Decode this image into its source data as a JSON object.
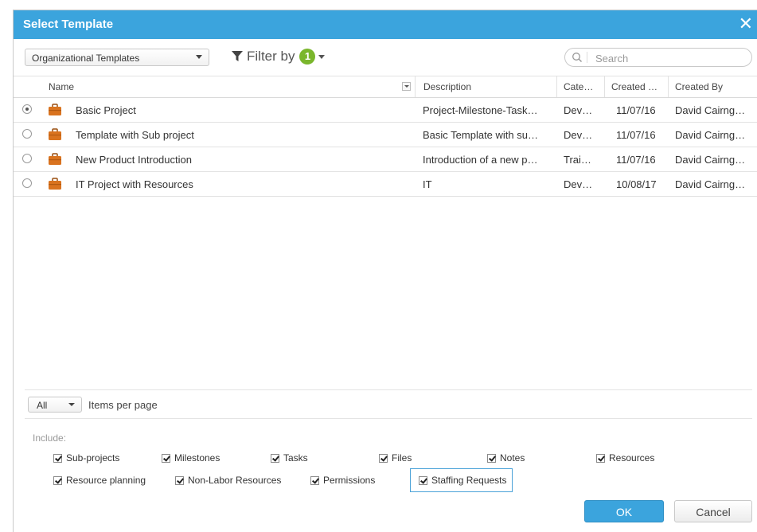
{
  "dialog": {
    "title": "Select Template",
    "close_glyph": "✕"
  },
  "toolbar": {
    "template_source": "Organizational Templates",
    "filter_label": "Filter by",
    "filter_count": "1",
    "search_placeholder": "Search"
  },
  "table": {
    "columns": {
      "name": "Name",
      "description": "Description",
      "category": "Cate…",
      "created": "Created …",
      "created_by": "Created By"
    },
    "rows": [
      {
        "name": "Basic Project",
        "description": "Project-Milestone-Task…",
        "category": "Dev…",
        "created": "11/07/16",
        "created_by": "David Cairng…",
        "selected": true
      },
      {
        "name": "Template with Sub project",
        "description": "Basic Template with su…",
        "category": "Dev…",
        "created": "11/07/16",
        "created_by": "David Cairng…",
        "selected": false
      },
      {
        "name": "New Product Introduction",
        "description": "Introduction of a new p…",
        "category": "Trai…",
        "created": "11/07/16",
        "created_by": "David Cairng…",
        "selected": false
      },
      {
        "name": "IT Project with Resources",
        "description": "IT",
        "category": "Dev…",
        "created": "10/08/17",
        "created_by": "David Cairng…",
        "selected": false
      }
    ]
  },
  "pagination": {
    "per_page_value": "All",
    "per_page_label": "Items per page"
  },
  "include": {
    "label": "Include:",
    "options": [
      "Sub-projects",
      "Milestones",
      "Tasks",
      "Files",
      "Notes",
      "Resources",
      "Resource planning",
      "Non-Labor Resources",
      "Permissions",
      "Staffing Requests"
    ]
  },
  "buttons": {
    "ok": "OK",
    "cancel": "Cancel"
  },
  "colors": {
    "title_bar": "#3ba4dd",
    "badge": "#7ab62c",
    "briefcase": "#d9731f"
  }
}
